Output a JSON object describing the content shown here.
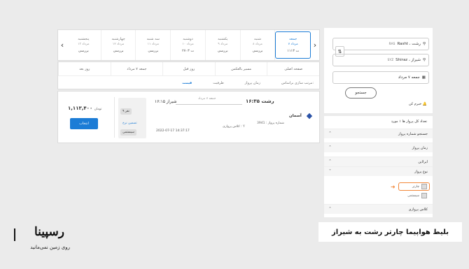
{
  "date_strip": {
    "prev_arrow": "‹",
    "next_arrow": "›",
    "days": [
      {
        "name": "پنجشنبه",
        "date": "۱۳ مرداد",
        "price": "بررسی"
      },
      {
        "name": "چهارشنبه",
        "date": "۱۲ مرداد",
        "price": "بررسی"
      },
      {
        "name": "سه شنبه",
        "date": "۱۱ مرداد",
        "price": "بررسی"
      },
      {
        "name": "دوشنبه",
        "date": "۱۰ مرداد",
        "price": "۲۷۰۳ ت"
      },
      {
        "name": "یکشنبه",
        "date": "۹ مرداد",
        "price": "بررسی"
      },
      {
        "name": "شنبه",
        "date": "۸ مرداد",
        "price": "بررسی"
      },
      {
        "name": "جمعه",
        "date": "۷ مرداد",
        "price": "۱۱۱۳ ت",
        "selected": true
      }
    ]
  },
  "sort": {
    "tabs": [
      "صفحه اصلی",
      "مسیر بالعکس",
      "روز قبل",
      "جمعه ۷ مرداد",
      "روز بعد"
    ],
    "label": "مرتب سازی براساس:",
    "options": [
      "زمان پرواز",
      "ظرفیت",
      "قیمت"
    ]
  },
  "result": {
    "price": "۱,۱۱۳,۴۰۰",
    "price_unit": "تومان",
    "select_label": "انتخاب",
    "seats": "۹ نفر",
    "guarantee": "تضمین نرخ",
    "system": "سیستمی",
    "dep_time": "رشت ۱۶:۳۵",
    "arr_time": "شیراز ۱۶:۱۵",
    "route_date": "جمعه ۷ مرداد",
    "airline": "آسمان",
    "flight_no": "شماره پرواز : 3941",
    "class": "کلاس پروازی : Y",
    "stamp": "2022-07-17 14:37:17"
  },
  "search": {
    "origin": "Rasht ، رشت",
    "origin_code": "RAS",
    "destination": "Shiraz ، شیراز",
    "destination_code": "SYZ",
    "date": "جمعه ۷ مرداد",
    "button": "جستجو",
    "news": "خبرم کن"
  },
  "filters": {
    "total": "تعداد کل پرواز ها ۱ مورد",
    "rows": [
      "جستجو شماره پرواز",
      "زمان پرواز",
      "ایرلاین",
      "نوع پرواز"
    ],
    "options": [
      "چارتر",
      "سیستمی"
    ],
    "class_row": "کلاس پروازی"
  },
  "caption": "بلیط هواپیما چارتر رشت به شیراز",
  "logo": {
    "main": "رسپینا",
    "sub": "روی زمین نمی‌مانید"
  },
  "colors": {
    "accent": "#1c7cd6",
    "highlight": "#f2883a",
    "background": "#ebebeb"
  }
}
